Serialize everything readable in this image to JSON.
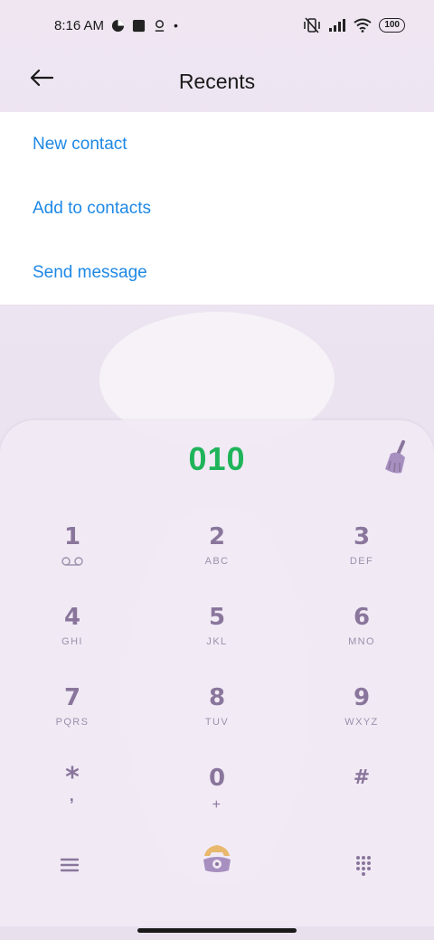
{
  "status_bar": {
    "time": "8:16 AM",
    "battery": "100"
  },
  "header": {
    "title": "Recents",
    "back_icon": "arrow-left-icon"
  },
  "menu": {
    "items": [
      {
        "label": "New contact"
      },
      {
        "label": "Add to contacts"
      },
      {
        "label": "Send message"
      }
    ]
  },
  "dialer": {
    "number": "010",
    "number_color": "#1fb45a",
    "keys": [
      {
        "digit": "1",
        "letters": ""
      },
      {
        "digit": "2",
        "letters": "ABC"
      },
      {
        "digit": "3",
        "letters": "DEF"
      },
      {
        "digit": "4",
        "letters": "GHI"
      },
      {
        "digit": "5",
        "letters": "JKL"
      },
      {
        "digit": "6",
        "letters": "MNO"
      },
      {
        "digit": "7",
        "letters": "PQRS"
      },
      {
        "digit": "8",
        "letters": "TUV"
      },
      {
        "digit": "9",
        "letters": "WXYZ"
      },
      {
        "digit": "*",
        "letters": ""
      },
      {
        "digit": "0",
        "letters": "+"
      },
      {
        "digit": "#",
        "letters": ""
      }
    ]
  },
  "colors": {
    "accent_blue": "#1e88e5",
    "key_purple": "#8a769c"
  }
}
